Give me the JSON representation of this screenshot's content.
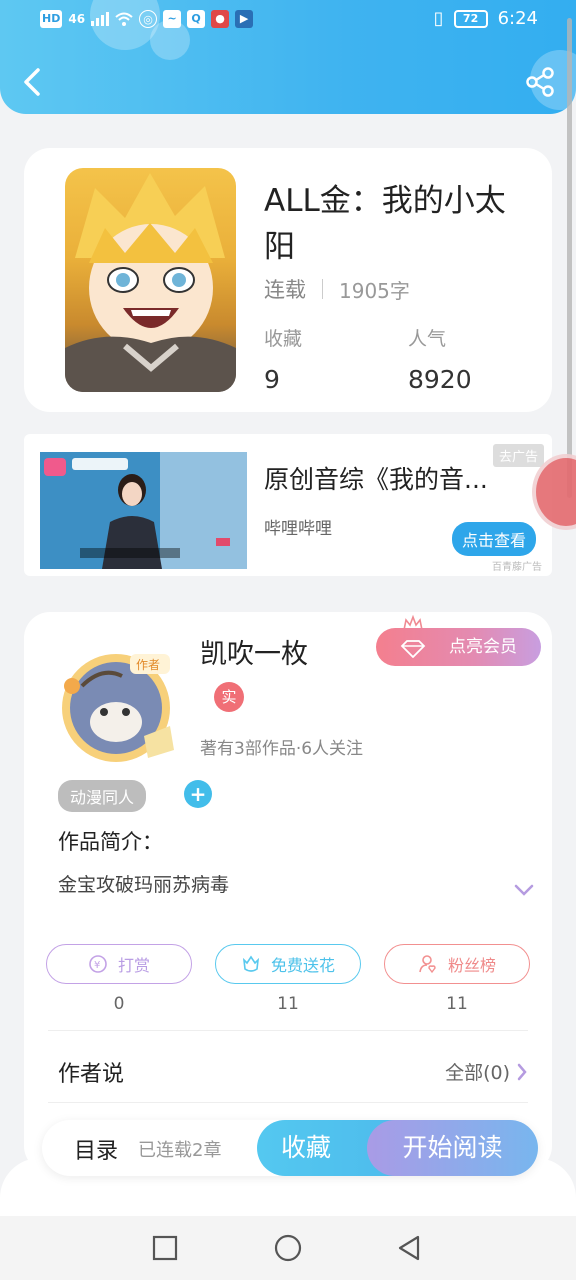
{
  "status_bar": {
    "left_labels": [
      "HD",
      "46"
    ],
    "time": "6:24",
    "battery": "72"
  },
  "book": {
    "title": "ALL金：我的小太阳",
    "status": "连载",
    "word_count": "1905字",
    "favorites_label": "收藏",
    "favorites_value": "9",
    "popularity_label": "人气",
    "popularity_value": "8920"
  },
  "ad": {
    "title": "原创音综《我的音...",
    "subtitle": "哔哩哔哩",
    "close_label": "去广告",
    "cta_label": "点击查看",
    "source": "百青藤广告"
  },
  "author": {
    "name": "凯吹一枚",
    "vip_label": "点亮会员",
    "real_badge": "实",
    "stats": "著有3部作品·6人关注",
    "tag": "动漫同人",
    "add_tag": "+",
    "intro_label": "作品简介：",
    "intro_text": "金宝攻破玛丽苏病毒",
    "actions": [
      {
        "label": "打赏",
        "count": "0",
        "color": "#c3a2e6"
      },
      {
        "label": "免费送花",
        "count": "11",
        "color": "#59c9ee"
      },
      {
        "label": "粉丝榜",
        "count": "11",
        "color": "#f29090"
      }
    ],
    "says_label": "作者说",
    "says_all": "全部(0)"
  },
  "action_bar": {
    "toc": "目录",
    "chapters": "已连载2章",
    "favorite": "收藏",
    "read": "开始阅读"
  },
  "icons": {
    "back": "back-arrow-icon",
    "share": "share-icon",
    "nav_recent": "square-icon",
    "nav_home": "circle-icon",
    "nav_back": "triangle-icon"
  }
}
